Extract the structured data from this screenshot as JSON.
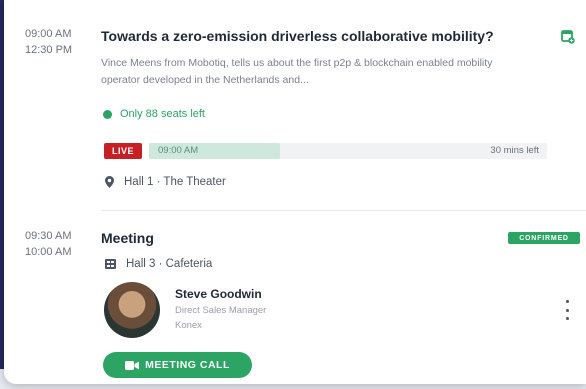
{
  "session1": {
    "start_time": "09:00 AM",
    "end_time": "12:30 PM",
    "title": "Towards a zero-emission driverless collaborative mobility?",
    "description": "Vince Meens from Mobotiq, tells us about the first p2p & blockchain enabled mobility operator developed in the Netherlands and...",
    "seats_left": "Only 88 seats left",
    "live_label": "LIVE",
    "progress_time": "09:00 AM",
    "time_left": "30 mins left",
    "progress_fraction": 0.33,
    "location": "Hall 1 · The Theater",
    "icon": "calendar-add-icon"
  },
  "session2": {
    "start_time": "09:30 AM",
    "end_time": "10:00 AM",
    "title": "Meeting",
    "status": "CONFIRMED",
    "location": "Hall 3 · Cafeteria",
    "person": {
      "name": "Steve Goodwin",
      "role": "Direct Sales Manager",
      "company": "Konex"
    },
    "meeting_button": "MEETING CALL"
  },
  "colors": {
    "accent_green": "#2ca463",
    "live_red": "#c62026",
    "background_navy": "#232a5c"
  }
}
